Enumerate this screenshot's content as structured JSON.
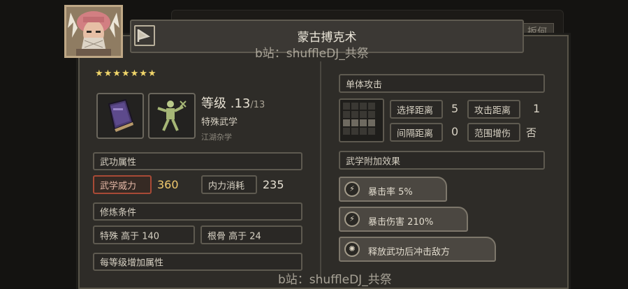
{
  "background_tag": "扳何",
  "title": "蒙古搏克术",
  "watermark": "b站：shuffleDJ_共祭",
  "watermark_bottom": "b站：shuffleDJ_共祭",
  "stars": "★★★★★★★",
  "level": {
    "label": "等级",
    "current": ".13",
    "max": "/13"
  },
  "category": "特殊武学",
  "subcategory": "江湖杂学",
  "sections": {
    "attributes": "武功属性",
    "requirements": "修炼条件",
    "per_level": "每等级增加属性"
  },
  "stats": {
    "power_label": "武学威力",
    "power_value": "360",
    "cost_label": "内力消耗",
    "cost_value": "235"
  },
  "requirements": {
    "req1": "特殊 高于 140",
    "req2": "根骨 高于 24"
  },
  "attack": {
    "type": "单体攻击",
    "select_range_label": "选择距离",
    "select_range_value": "5",
    "attack_range_label": "攻击距离",
    "attack_range_value": "1",
    "interval_label": "间隔距离",
    "interval_value": "0",
    "area_label": "范围增伤",
    "area_value": "否"
  },
  "effects_header": "武学附加效果",
  "effects": [
    {
      "text": "暴击率 5%",
      "icon": "lightning-icon"
    },
    {
      "text": "暴击伤害 210%",
      "icon": "lightning-icon"
    },
    {
      "text": "释放武功后冲击敌方",
      "icon": "burst-icon"
    }
  ],
  "colors": {
    "star": "#f0d56a",
    "power_frame": "#a84a36",
    "panel": "#2e2c28"
  }
}
